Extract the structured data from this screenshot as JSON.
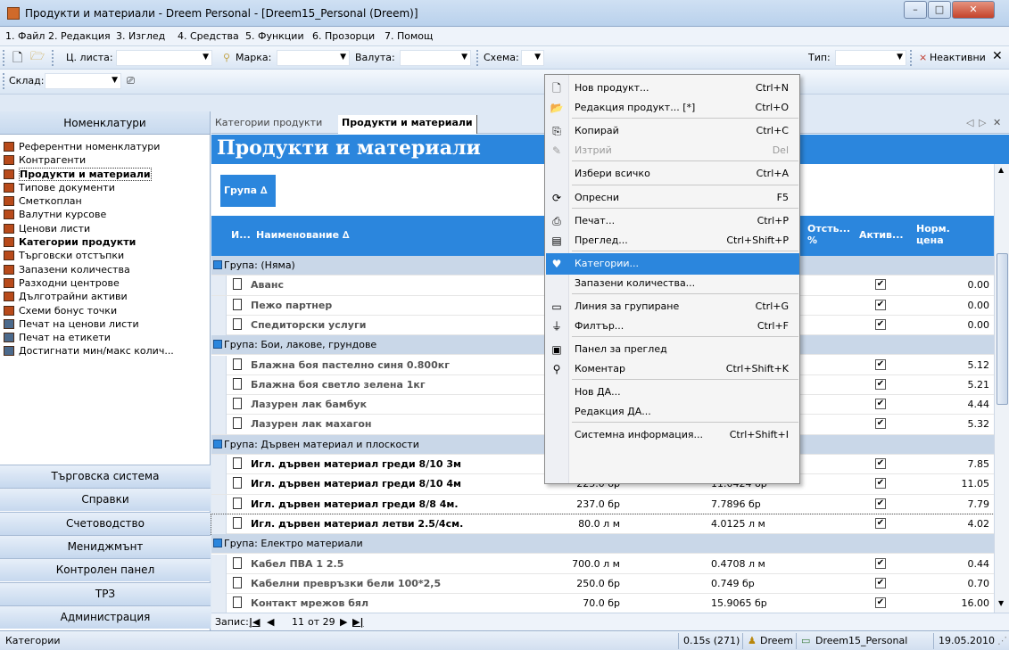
{
  "window": {
    "title": "Продукти и материали - Dreem Personal - [Dreem15_Personal (Dreem)]"
  },
  "menu": [
    "1. Файл",
    "2. Редакция",
    "3. Изглед",
    "4. Средства",
    "5. Функции",
    "6. Прозорци",
    "7. Помощ"
  ],
  "toolbar": {
    "price_list_label": "Ц. листа:",
    "brand_label": "Марка:",
    "currency_label": "Валута:",
    "scheme_label": "Схема:",
    "type_label": "Тип:",
    "inactive_label": "Неактивни",
    "warehouse_label": "Склад:"
  },
  "left_pane": {
    "header": "Номенклатури",
    "items": [
      {
        "label": "Референтни номенклатури",
        "bold": false
      },
      {
        "label": "Контрагенти",
        "bold": false
      },
      {
        "label": "Продукти и материали",
        "bold": true
      },
      {
        "label": "Типове документи",
        "bold": false
      },
      {
        "label": "Сметкоплан",
        "bold": false
      },
      {
        "label": "Валутни курсове",
        "bold": false
      },
      {
        "label": "Ценови листи",
        "bold": false
      },
      {
        "label": "Категории продукти",
        "bold": true
      },
      {
        "label": "Търговски отстъпки",
        "bold": false
      },
      {
        "label": "Запазени количества",
        "bold": false
      },
      {
        "label": "Разходни центрове",
        "bold": false
      },
      {
        "label": "Дълготрайни активи",
        "bold": false
      },
      {
        "label": "Схеми бонус точки",
        "bold": false
      },
      {
        "label": "Печат на ценови листи",
        "bold": false
      },
      {
        "label": "Печат на етикети",
        "bold": false
      },
      {
        "label": "Достигнати мин/макс колич...",
        "bold": false
      }
    ],
    "sections": [
      "Търговска система",
      "Справки",
      "Счетоводство",
      "Мениджмънт",
      "Контролен панел",
      "ТРЗ",
      "Администрация"
    ]
  },
  "tabs": [
    "Категории продукти",
    "Продукти и материали"
  ],
  "page_title": "Продукти и материали",
  "group_box": "Група ∆",
  "columns": {
    "index": "И...",
    "name": "Наименование ∆",
    "discount": "Отсть... %",
    "active": "Актив...",
    "norm_price": "Норм. цена"
  },
  "rows": [
    {
      "type": "group",
      "label": "Група: (Няма)"
    },
    {
      "type": "item",
      "name": "Аванс",
      "qty": "",
      "unit_price": "",
      "active": true,
      "price": "0.00",
      "bold": false
    },
    {
      "type": "item",
      "name": "Пежо партнер",
      "qty": "",
      "unit_price": "",
      "active": true,
      "price": "0.00",
      "bold": false
    },
    {
      "type": "item",
      "name": "Спедиторски услуги",
      "qty": "",
      "unit_price": "",
      "active": true,
      "price": "0.00",
      "bold": false
    },
    {
      "type": "group",
      "label": "Група: Бои, лакове, грундове"
    },
    {
      "type": "item",
      "name": "Блажна боя пастелно синя 0.800кг",
      "qty": "",
      "unit_price": "",
      "active": true,
      "price": "5.12",
      "bold": false
    },
    {
      "type": "item",
      "name": "Блажна боя светло зелена 1кг",
      "qty": "",
      "unit_price": "",
      "active": true,
      "price": "5.21",
      "bold": false
    },
    {
      "type": "item",
      "name": "Лазурен лак бамбук",
      "qty": "",
      "unit_price": "",
      "active": true,
      "price": "4.44",
      "bold": false
    },
    {
      "type": "item",
      "name": "Лазурен лак махагон",
      "qty": "",
      "unit_price": "",
      "active": true,
      "price": "5.32",
      "bold": false
    },
    {
      "type": "group",
      "label": "Група: Дървен материал и плоскости"
    },
    {
      "type": "item",
      "name": "Игл. дървен материал греди 8/10 3м",
      "qty": "",
      "unit_price": "",
      "active": true,
      "price": "7.85",
      "bold": true
    },
    {
      "type": "item",
      "name": "Игл. дървен материал греди 8/10 4м",
      "qty": "225.0 бр",
      "unit_price": "11.0424 бр",
      "active": true,
      "price": "11.05",
      "bold": true
    },
    {
      "type": "item",
      "name": "Игл. дървен материал греди 8/8 4м.",
      "qty": "237.0 бр",
      "unit_price": "7.7896 бр",
      "active": true,
      "price": "7.79",
      "bold": true
    },
    {
      "type": "item",
      "name": "Игл. дървен материал летви 2.5/4см.",
      "qty": "80.0 л м",
      "unit_price": "4.0125 л м",
      "active": true,
      "price": "4.02",
      "bold": true,
      "current": true
    },
    {
      "type": "group",
      "label": "Група: Електро материали"
    },
    {
      "type": "item",
      "name": "Кабел ПВА 1 2.5",
      "qty": "700.0 л м",
      "unit_price": "0.4708 л м",
      "active": true,
      "price": "0.44",
      "bold": false
    },
    {
      "type": "item",
      "name": "Кабелни превръзки бели 100*2,5",
      "qty": "250.0 бр",
      "unit_price": "0.749 бр",
      "active": true,
      "price": "0.70",
      "bold": false
    },
    {
      "type": "item",
      "name": "Контакт мрежов бял",
      "qty": "70.0 бр",
      "unit_price": "15.9065 бр",
      "active": true,
      "price": "16.00",
      "bold": false
    }
  ],
  "record_nav": {
    "label": "Запис:",
    "current": "11",
    "of": "от 29"
  },
  "context_menu": [
    {
      "icon": "new-icon",
      "glyph": "🗋",
      "label": "Нов продукт...",
      "shortcut": "Ctrl+N"
    },
    {
      "icon": "edit-icon",
      "glyph": "📂",
      "label": "Редакция продукт... [*]",
      "shortcut": "Ctrl+O"
    },
    {
      "sep": true
    },
    {
      "icon": "copy-icon",
      "glyph": "⎘",
      "label": "Копирай",
      "shortcut": "Ctrl+C"
    },
    {
      "icon": "delete-icon",
      "glyph": "✎",
      "label": "Изтрий",
      "shortcut": "Del",
      "disabled": true
    },
    {
      "sep": true
    },
    {
      "icon": "",
      "glyph": "",
      "label": "Избери всичко",
      "shortcut": "Ctrl+A"
    },
    {
      "sep": true
    },
    {
      "icon": "refresh-icon",
      "glyph": "⟳",
      "label": "Опресни",
      "shortcut": "F5"
    },
    {
      "sep": true
    },
    {
      "icon": "print-icon",
      "glyph": "⎙",
      "label": "Печат...",
      "shortcut": "Ctrl+P"
    },
    {
      "icon": "preview-icon",
      "glyph": "▤",
      "label": "Преглед...",
      "shortcut": "Ctrl+Shift+P"
    },
    {
      "sep": true
    },
    {
      "icon": "categories-icon",
      "glyph": "♥",
      "label": "Категории...",
      "shortcut": "",
      "highlight": true
    },
    {
      "icon": "",
      "glyph": "",
      "label": "Запазени количества...",
      "shortcut": ""
    },
    {
      "sep": true
    },
    {
      "icon": "grouping-icon",
      "glyph": "▭",
      "label": "Линия за групиране",
      "shortcut": "Ctrl+G"
    },
    {
      "icon": "filter-icon",
      "glyph": "⏚",
      "label": "Филтър...",
      "shortcut": "Ctrl+F"
    },
    {
      "sep": true
    },
    {
      "icon": "panel-icon",
      "glyph": "▣",
      "label": "Панел за преглед",
      "shortcut": ""
    },
    {
      "icon": "comment-icon",
      "glyph": "⚲",
      "label": "Коментар",
      "shortcut": "Ctrl+Shift+K"
    },
    {
      "sep": true
    },
    {
      "icon": "",
      "glyph": "",
      "label": "Нов ДА...",
      "shortcut": ""
    },
    {
      "icon": "",
      "glyph": "",
      "label": "Редакция ДА...",
      "shortcut": ""
    },
    {
      "sep": true
    },
    {
      "icon": "",
      "glyph": "",
      "label": "Системна информация...",
      "shortcut": "Ctrl+Shift+I"
    }
  ],
  "status": {
    "left": "Категории",
    "timing": "0.15s (271)",
    "user": "Dreem",
    "db": "Dreem15_Personal",
    "date": "19.05.2010"
  }
}
